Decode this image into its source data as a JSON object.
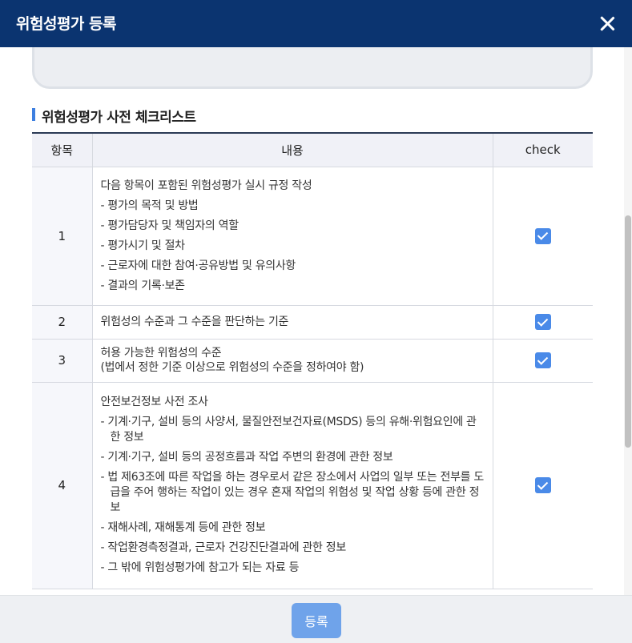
{
  "modal": {
    "title": "위험성평가 등록",
    "close_icon": "close-icon"
  },
  "section": {
    "title": "위험성평가 사전 체크리스트"
  },
  "table": {
    "headers": [
      "항목",
      "내용",
      "check"
    ],
    "rows": [
      {
        "num": "1",
        "lines": [
          "다음 항목이 포함된 위험성평가 실시 규정 작성",
          "- 평가의 목적 및 방법",
          "- 평가담당자 및 책임자의 역할",
          "- 평가시기 및 절차",
          "- 근로자에 대한 참여·공유방법 및 유의사항",
          "- 결과의 기록·보존"
        ],
        "checked": true
      },
      {
        "num": "2",
        "lines": [
          "위험성의 수준과 그 수준을 판단하는 기준"
        ],
        "checked": true
      },
      {
        "num": "3",
        "lines": [
          "허용 가능한 위험성의 수준",
          "(법에서 정한 기준 이상으로 위험성의 수준을 정하여야 함)"
        ],
        "checked": true
      },
      {
        "num": "4",
        "lines": [
          "안전보건정보 사전 조사",
          "- 기계·기구, 설비 등의 사양서, 물질안전보건자료(MSDS) 등의 유해·위험요인에 관한 정보",
          "- 기계·기구, 설비 등의 공정흐름과 작업 주변의 환경에 관한 정보",
          "- 법 제63조에 따른 작업을 하는 경우로서 같은 장소에서 사업의 일부 또는 전부를 도급을 주어 행하는 작업이 있는 경우 혼재 작업의 위험성 및 작업 상황 등에 관한 정보",
          "- 재해사례, 재해통계 등에 관한 정보",
          "- 작업환경측정결과, 근로자 건강진단결과에 관한 정보",
          "- 그 밖에 위험성평가에 참고가 되는 자료 등"
        ],
        "checked": true
      }
    ]
  },
  "footer": {
    "submit_label": "등록"
  },
  "colors": {
    "header_bg": "#0b3470",
    "accent": "#3d7fe0",
    "checkbox": "#4a8ae8",
    "submit_button": "#6fa3ea"
  }
}
